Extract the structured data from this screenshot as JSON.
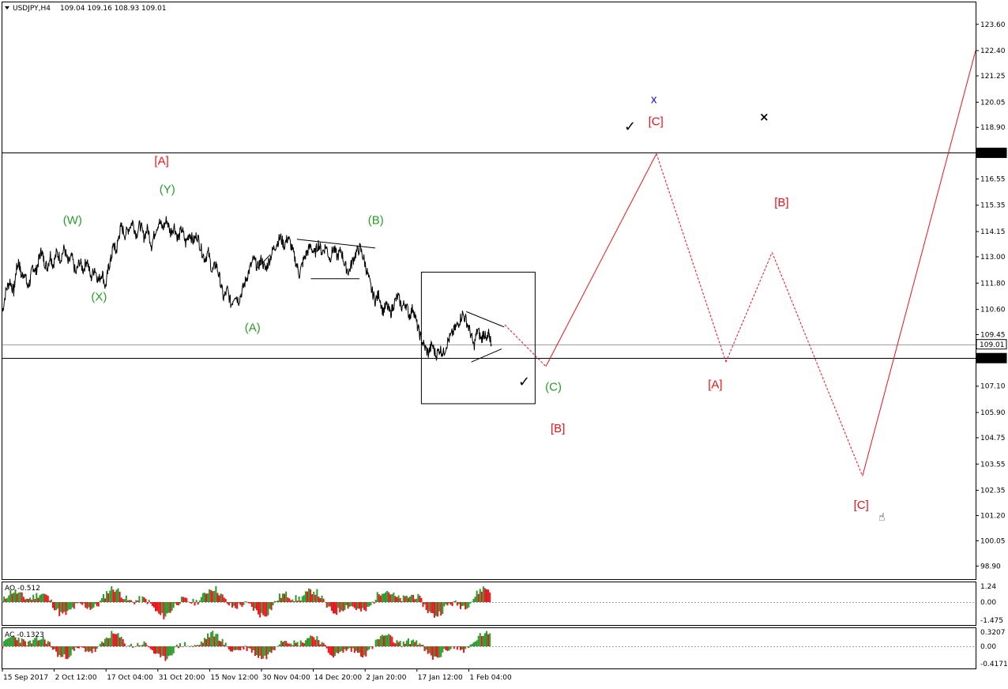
{
  "header": {
    "symbol": "USDJPY,H4",
    "ohlc": "109.04 109.16 108.93 109.01"
  },
  "colors": {
    "red": "#e8141c",
    "green": "#2a9a2a",
    "blue": "#1010e0",
    "line": "#000000"
  },
  "chart_data": {
    "type": "line",
    "ylim": [
      98.3,
      124.6
    ],
    "yticks": [
      "123.60",
      "122.40",
      "121.25",
      "120.05",
      "118.90",
      "116.55",
      "115.35",
      "114.15",
      "113.00",
      "111.80",
      "110.60",
      "109.45",
      "107.10",
      "105.90",
      "104.75",
      "103.55",
      "102.35",
      "101.20",
      "100.05",
      "98.90"
    ],
    "hlines": [
      {
        "value": 117.74,
        "label": "117.74",
        "color": "#000000"
      },
      {
        "value": 108.38,
        "label": "108.38",
        "color": "#000000"
      },
      {
        "value": 109.01,
        "label": "109.01",
        "color": "#a0a0a0"
      }
    ],
    "xticks": [
      {
        "x": 0,
        "label": "15 Sep 2017"
      },
      {
        "x": 82,
        "label": "2 Oct 12:00"
      },
      {
        "x": 164,
        "label": "17 Oct 04:00"
      },
      {
        "x": 246,
        "label": "31 Oct 20:00"
      },
      {
        "x": 328,
        "label": "15 Nov 12:00"
      },
      {
        "x": 410,
        "label": "30 Nov 04:00"
      },
      {
        "x": 492,
        "label": "14 Dec 20:00"
      },
      {
        "x": 574,
        "label": "2 Jan 20:00"
      },
      {
        "x": 656,
        "label": "17 Jan 12:00"
      },
      {
        "x": 738,
        "label": "1 Feb 04:00"
      }
    ],
    "xlim": [
      0,
      1540
    ],
    "price": [
      [
        0,
        110.5
      ],
      [
        6,
        111.5
      ],
      [
        12,
        111.9
      ],
      [
        18,
        111.4
      ],
      [
        22,
        112.4
      ],
      [
        26,
        112.8
      ],
      [
        30,
        112.1
      ],
      [
        35,
        112.3
      ],
      [
        40,
        111.6
      ],
      [
        44,
        111.9
      ],
      [
        48,
        112.6
      ],
      [
        53,
        112.3
      ],
      [
        58,
        112.9
      ],
      [
        62,
        113.3
      ],
      [
        66,
        112.8
      ],
      [
        71,
        112.5
      ],
      [
        76,
        113.1
      ],
      [
        80,
        112.6
      ],
      [
        86,
        113.2
      ],
      [
        92,
        112.9
      ],
      [
        98,
        113.4
      ],
      [
        104,
        112.7
      ],
      [
        110,
        113.0
      ],
      [
        116,
        112.2
      ],
      [
        122,
        112.8
      ],
      [
        128,
        112.4
      ],
      [
        134,
        112.9
      ],
      [
        140,
        112.0
      ],
      [
        146,
        112.5
      ],
      [
        152,
        111.9
      ],
      [
        158,
        112.3
      ],
      [
        163,
        111.6
      ],
      [
        168,
        112.5
      ],
      [
        172,
        112.9
      ],
      [
        176,
        113.6
      ],
      [
        180,
        113.2
      ],
      [
        184,
        113.9
      ],
      [
        188,
        114.4
      ],
      [
        194,
        114.0
      ],
      [
        200,
        114.3
      ],
      [
        206,
        114.6
      ],
      [
        212,
        114.0
      ],
      [
        218,
        114.5
      ],
      [
        224,
        113.9
      ],
      [
        230,
        114.3
      ],
      [
        236,
        113.5
      ],
      [
        242,
        114.2
      ],
      [
        248,
        114.6
      ],
      [
        254,
        114.3
      ],
      [
        260,
        114.7
      ],
      [
        266,
        114.1
      ],
      [
        272,
        114.4
      ],
      [
        278,
        113.8
      ],
      [
        284,
        114.3
      ],
      [
        290,
        113.6
      ],
      [
        296,
        114.1
      ],
      [
        302,
        113.7
      ],
      [
        308,
        114.0
      ],
      [
        314,
        113.4
      ],
      [
        320,
        112.9
      ],
      [
        326,
        113.2
      ],
      [
        332,
        112.3
      ],
      [
        338,
        112.7
      ],
      [
        344,
        112.0
      ],
      [
        350,
        111.1
      ],
      [
        356,
        111.5
      ],
      [
        362,
        110.8
      ],
      [
        368,
        111.3
      ],
      [
        374,
        111.0
      ],
      [
        380,
        111.5
      ],
      [
        386,
        112.0
      ],
      [
        392,
        112.5
      ],
      [
        398,
        112.9
      ],
      [
        404,
        112.5
      ],
      [
        410,
        112.9
      ],
      [
        416,
        112.4
      ],
      [
        422,
        112.8
      ],
      [
        428,
        113.3
      ],
      [
        434,
        113.6
      ],
      [
        440,
        113.9
      ],
      [
        446,
        113.5
      ],
      [
        452,
        113.9
      ],
      [
        458,
        113.4
      ],
      [
        464,
        112.8
      ],
      [
        470,
        112.2
      ],
      [
        476,
        112.8
      ],
      [
        482,
        113.2
      ],
      [
        488,
        113.5
      ],
      [
        494,
        113.1
      ],
      [
        500,
        113.6
      ],
      [
        506,
        113.2
      ],
      [
        512,
        113.5
      ],
      [
        518,
        112.9
      ],
      [
        524,
        113.4
      ],
      [
        530,
        113.0
      ],
      [
        536,
        113.3
      ],
      [
        542,
        112.6
      ],
      [
        548,
        112.3
      ],
      [
        554,
        112.8
      ],
      [
        560,
        113.2
      ],
      [
        566,
        113.4
      ],
      [
        572,
        112.9
      ],
      [
        578,
        112.2
      ],
      [
        584,
        111.5
      ],
      [
        590,
        111.0
      ],
      [
        596,
        111.3
      ],
      [
        602,
        110.5
      ],
      [
        608,
        110.8
      ],
      [
        614,
        110.4
      ],
      [
        620,
        110.9
      ],
      [
        626,
        111.2
      ],
      [
        632,
        110.7
      ],
      [
        638,
        110.9
      ],
      [
        644,
        110.3
      ],
      [
        650,
        110.7
      ],
      [
        656,
        109.9
      ],
      [
        662,
        109.3
      ],
      [
        668,
        108.9
      ],
      [
        674,
        108.6
      ],
      [
        680,
        109.0
      ],
      [
        686,
        108.5
      ],
      [
        692,
        108.8
      ],
      [
        698,
        108.6
      ],
      [
        704,
        109.1
      ],
      [
        710,
        109.4
      ],
      [
        716,
        109.7
      ],
      [
        722,
        110.0
      ],
      [
        728,
        110.4
      ],
      [
        734,
        110.1
      ],
      [
        740,
        109.6
      ],
      [
        746,
        108.9
      ],
      [
        752,
        109.7
      ],
      [
        758,
        109.2
      ],
      [
        762,
        109.6
      ],
      [
        766,
        109.1
      ],
      [
        770,
        109.5
      ],
      [
        774,
        109.01
      ]
    ],
    "ao": {
      "scale_max": 1.24,
      "scale_min": -1.475,
      "labels": [
        "1.24",
        "0.00",
        "-1.475"
      ],
      "title": "AO -0.512"
    },
    "ac": {
      "scale_max": 0.3207,
      "scale_min": -0.4171,
      "labels": [
        "0.3207",
        "0.00",
        "-0.4171"
      ],
      "title": "AC -0.1323"
    },
    "wave_labels": [
      {
        "text": "[A]",
        "x": 252,
        "y": 117.2,
        "color": "red"
      },
      {
        "text": "(Y)",
        "x": 261,
        "y": 115.9,
        "color": "green"
      },
      {
        "text": "(W)",
        "x": 111,
        "y": 114.5,
        "color": "green"
      },
      {
        "text": "(X)",
        "x": 153,
        "y": 111.0,
        "color": "green"
      },
      {
        "text": "(A)",
        "x": 396,
        "y": 109.6,
        "color": "green"
      },
      {
        "text": "(B)",
        "x": 591,
        "y": 114.5,
        "color": "green"
      },
      {
        "text": "(C)",
        "x": 872,
        "y": 106.9,
        "color": "green"
      },
      {
        "text": "[B]",
        "x": 879,
        "y": 105.0,
        "color": "red"
      },
      {
        "text": "x",
        "x": 1031,
        "y": 120.0,
        "color": "blue"
      },
      {
        "text": "[C]",
        "x": 1034,
        "y": 119.0,
        "color": "red"
      },
      {
        "text": "[B]",
        "x": 1233,
        "y": 115.3,
        "color": "red"
      },
      {
        "text": "[A]",
        "x": 1128,
        "y": 107.0,
        "color": "red"
      },
      {
        "text": "[C]",
        "x": 1359,
        "y": 101.5,
        "color": "red"
      }
    ],
    "projection_dashed": [
      [
        795,
        109.9
      ],
      [
        860,
        108.0
      ],
      [
        1035,
        117.7
      ],
      [
        1145,
        108.2
      ],
      [
        1218,
        113.2
      ],
      [
        1361,
        103.0
      ],
      [
        1540,
        122.4
      ]
    ]
  }
}
